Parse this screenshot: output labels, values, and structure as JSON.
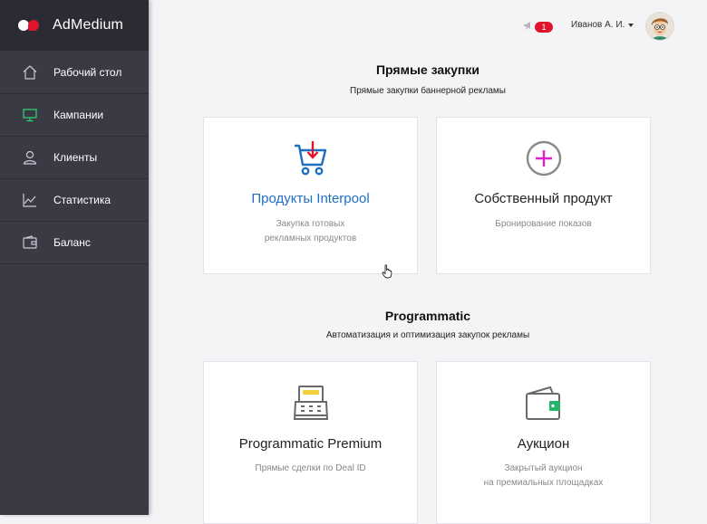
{
  "brand": {
    "name": "AdMedium"
  },
  "sidebar": {
    "items": [
      {
        "label": "Рабочий стол",
        "icon": "home-icon"
      },
      {
        "label": "Кампании",
        "icon": "monitor-icon",
        "active": true
      },
      {
        "label": "Клиенты",
        "icon": "user-icon"
      },
      {
        "label": "Статистика",
        "icon": "chart-icon"
      },
      {
        "label": "Баланс",
        "icon": "wallet-icon"
      }
    ]
  },
  "header": {
    "notifications_count": "1",
    "user_name": "Иванов А. И."
  },
  "sections": [
    {
      "title": "Прямые закупки",
      "subtitle": "Прямые закупки баннерной рекламы",
      "cards": [
        {
          "title": "Продукты Interpool",
          "desc_line1": "Закупка готовых",
          "desc_line2": "рекламных продуктов",
          "icon": "cart-icon"
        },
        {
          "title": "Собственный продукт",
          "desc_line1": "Бронирование показов",
          "desc_line2": "",
          "icon": "plus-circle-icon"
        }
      ]
    },
    {
      "title": "Programmatic",
      "subtitle": "Автоматизация и оптимизация закупок рекламы",
      "cards": [
        {
          "title": "Programmatic Premium",
          "desc_line1": "Прямые сделки по Deal ID",
          "desc_line2": "",
          "icon": "cash-register-icon"
        },
        {
          "title": "Аукцион",
          "desc_line1": "Закрытый аукцион",
          "desc_line2": "на премиальных площадках",
          "icon": "wallet-icon"
        }
      ]
    }
  ],
  "colors": {
    "sidebar_bg": "#3a3a45",
    "brand_bg": "#2b2b33",
    "accent_red": "#e0152b",
    "active_green": "#2ecc71",
    "link_blue": "#1e6fc2",
    "plus_magenta": "#e020c8"
  }
}
